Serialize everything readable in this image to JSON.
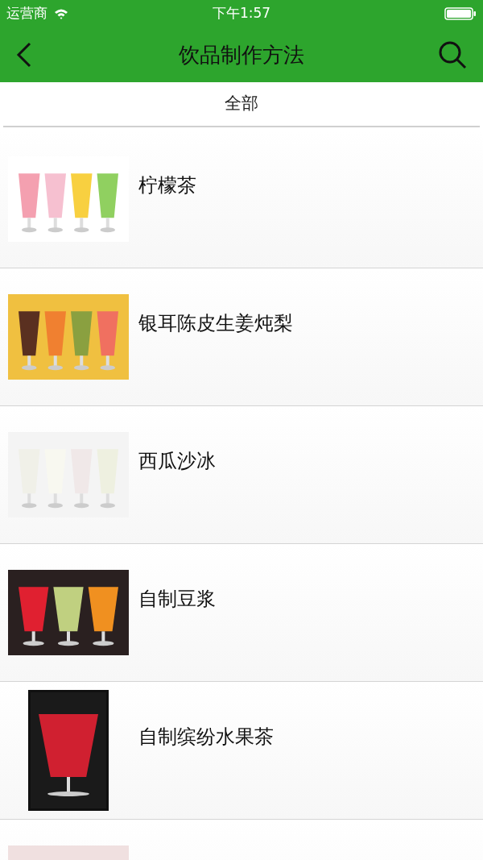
{
  "status_bar": {
    "carrier": "运营商",
    "time": "下午1:57"
  },
  "nav": {
    "title": "饮品制作方法"
  },
  "tabs": [
    {
      "label": "全部",
      "selected": true
    }
  ],
  "items": [
    {
      "title": "柠檬茶",
      "kind": "wide"
    },
    {
      "title": "银耳陈皮生姜炖梨",
      "kind": "wide"
    },
    {
      "title": "西瓜沙冰",
      "kind": "wide"
    },
    {
      "title": "自制豆浆",
      "kind": "wide"
    },
    {
      "title": "自制缤纷水果茶",
      "kind": "tall"
    },
    {
      "kind": "wide"
    }
  ]
}
